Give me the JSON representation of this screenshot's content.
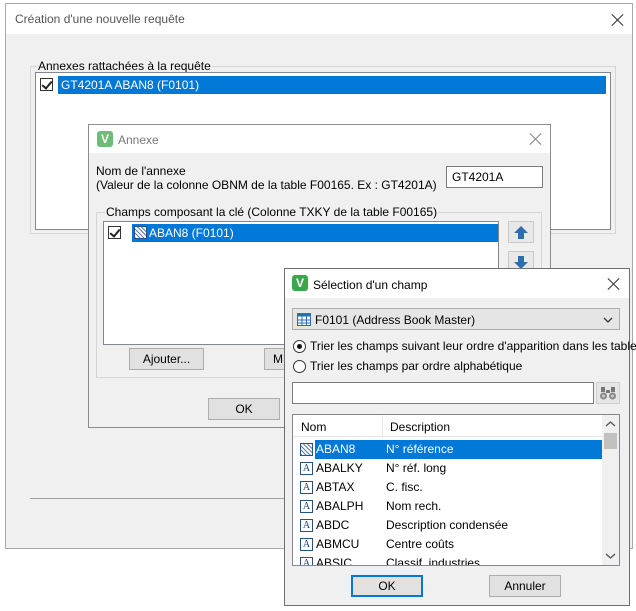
{
  "main_window": {
    "title": "Création d'une nouvelle requête",
    "group_label": "Annexes rattachées à la requête",
    "annexes": [
      {
        "label": "GT4201A ABAN8 (F0101)",
        "checked": true
      }
    ]
  },
  "annexe_dialog": {
    "title": "Annexe",
    "name_label_line1": "Nom de l'annexe",
    "name_label_line2": "(Valeur de la colonne OBNM de la table F00165. Ex : GT4201A)",
    "name_value": "GT4201A",
    "fields_group_label": "Champs composant la clé (Colonne TXKY de la table F00165)",
    "fields": [
      {
        "label": "ABAN8 (F0101)",
        "checked": true
      }
    ],
    "add_button": "Ajouter...",
    "modify_button_partial": "M",
    "ok_button": "OK"
  },
  "select_dialog": {
    "title": "Sélection d'un champ",
    "table_dropdown": "F0101 (Address Book Master)",
    "radio_order": "Trier les champs suivant leur ordre d'apparition dans les tables",
    "radio_alpha": "Trier les champs par ordre alphabétique",
    "radio_selected": "order",
    "search_value": "",
    "col_name": "Nom",
    "col_desc": "Description",
    "rows": [
      {
        "name": "ABAN8",
        "desc": "N° référence",
        "icon": "key-field-icon"
      },
      {
        "name": "ABALKY",
        "desc": "N° réf. long",
        "icon": "alpha-field-icon"
      },
      {
        "name": "ABTAX",
        "desc": "C. fisc.",
        "icon": "alpha-field-icon"
      },
      {
        "name": "ABALPH",
        "desc": "Nom rech.",
        "icon": "alpha-field-icon"
      },
      {
        "name": "ABDC",
        "desc": "Description condensée",
        "icon": "alpha-field-icon"
      },
      {
        "name": "ABMCU",
        "desc": "Centre coûts",
        "icon": "alpha-field-icon"
      },
      {
        "name": "ABSIC",
        "desc": "Classif. industries",
        "icon": "alpha-field-icon"
      }
    ],
    "selected_row": 0,
    "ok_button": "OK",
    "cancel_button": "Annuler"
  },
  "colors": {
    "selection": "#0078d7",
    "logo_green": "#3aa84a"
  }
}
